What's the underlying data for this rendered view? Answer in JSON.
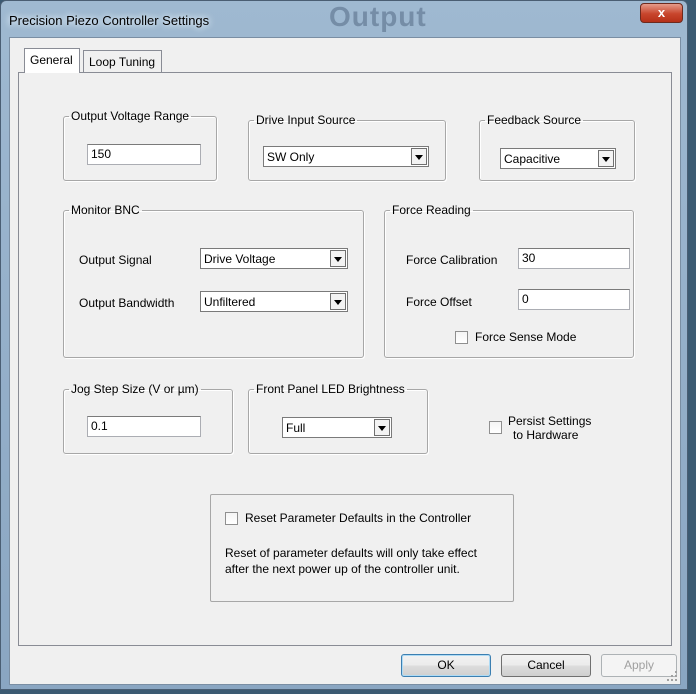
{
  "window": {
    "title": "Precision Piezo Controller Settings",
    "ghost_title": "Output",
    "close_glyph": "x"
  },
  "tabs": [
    {
      "label": "General",
      "active": true
    },
    {
      "label": "Loop Tuning",
      "active": false
    }
  ],
  "output_voltage": {
    "label": "Output Voltage Range",
    "value": "150"
  },
  "drive_input": {
    "label": "Drive Input Source",
    "value": "SW Only"
  },
  "feedback": {
    "label": "Feedback Source",
    "value": "Capacitive"
  },
  "monitor_bnc": {
    "label": "Monitor BNC",
    "output_signal_label": "Output Signal",
    "output_signal_value": "Drive Voltage",
    "output_bandwidth_label": "Output Bandwidth",
    "output_bandwidth_value": "Unfiltered"
  },
  "force_reading": {
    "label": "Force Reading",
    "calibration_label": "Force Calibration",
    "calibration_value": "30",
    "offset_label": "Force Offset",
    "offset_value": "0",
    "sense_mode_label": "Force Sense Mode"
  },
  "jog_step": {
    "label": "Jog Step Size (V or µm)",
    "value": "0.1"
  },
  "led_brightness": {
    "label": "Front Panel LED Brightness",
    "value": "Full"
  },
  "persist": {
    "line1": "Persist Settings",
    "line2": "to Hardware"
  },
  "reset": {
    "label": "Reset Parameter Defaults in the Controller",
    "note_line1": "Reset of parameter defaults will only take effect",
    "note_line2": "after the next power up of the controller unit."
  },
  "buttons": {
    "ok": "OK",
    "cancel": "Cancel",
    "apply": "Apply"
  },
  "colors": {
    "title_glass": "#9fb9d1",
    "close_red": "#c8452c",
    "dialog_bg": "#f0f0f0"
  }
}
